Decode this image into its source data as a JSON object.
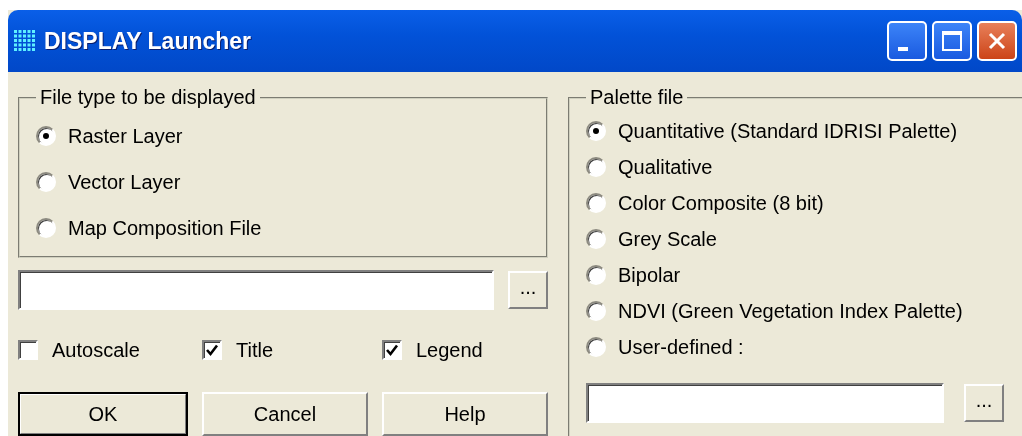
{
  "window": {
    "title": "DISPLAY Launcher"
  },
  "file_type": {
    "label": "File type to be displayed",
    "options": [
      {
        "label": "Raster Layer",
        "selected": true
      },
      {
        "label": "Vector Layer",
        "selected": false
      },
      {
        "label": "Map Composition File",
        "selected": false
      }
    ],
    "browse_button": "..."
  },
  "options": [
    {
      "label": "Autoscale",
      "checked": false
    },
    {
      "label": "Title",
      "checked": true
    },
    {
      "label": "Legend",
      "checked": true
    }
  ],
  "buttons": [
    {
      "label": "OK",
      "default": true
    },
    {
      "label": "Cancel",
      "default": false
    },
    {
      "label": "Help",
      "default": false
    }
  ],
  "palette": {
    "label": "Palette file",
    "options": [
      {
        "label": "Quantitative (Standard IDRISI Palette)",
        "selected": true
      },
      {
        "label": "Qualitative",
        "selected": false
      },
      {
        "label": "Color Composite (8 bit)",
        "selected": false
      },
      {
        "label": "Grey Scale",
        "selected": false
      },
      {
        "label": "Bipolar",
        "selected": false
      },
      {
        "label": "NDVI (Green Vegetation Index Palette)",
        "selected": false
      },
      {
        "label": "User-defined :",
        "selected": false
      }
    ],
    "browse_button": "..."
  }
}
